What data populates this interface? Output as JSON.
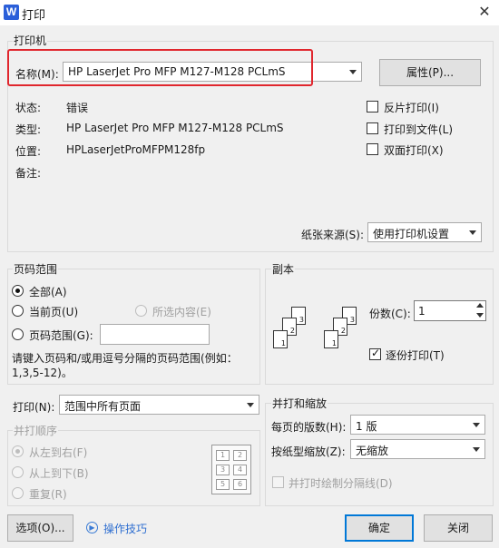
{
  "window": {
    "title": "打印",
    "app_icon": "W",
    "close": "✕"
  },
  "printer": {
    "group_title": "打印机",
    "name_label": "名称(M):",
    "selected": "HP LaserJet Pro MFP M127-M128 PCLmS",
    "properties_button": "属性(P)...",
    "status_label": "状态:",
    "status_value": "错误",
    "type_label": "类型:",
    "type_value": "HP LaserJet Pro MFP M127-M128 PCLmS",
    "location_label": "位置:",
    "location_value": "HPLaserJetProMFPM128fp",
    "comment_label": "备注:",
    "options": [
      {
        "label": "反片打印(I)",
        "checked": false
      },
      {
        "label": "打印到文件(L)",
        "checked": false
      },
      {
        "label": "双面打印(X)",
        "checked": false
      }
    ],
    "paper_source_label": "纸张来源(S):",
    "paper_source_value": "使用打印机设置"
  },
  "page_range": {
    "group_title": "页码范围",
    "all": "全部(A)",
    "current": "当前页(U)",
    "selection": "所选内容(E)",
    "range": "页码范围(G):",
    "range_value": "",
    "hint": "请键入页码和/或用逗号分隔的页码范围(例如：1,3,5-12)。"
  },
  "copies": {
    "group_title": "副本",
    "count_label": "份数(C):",
    "count_value": "1",
    "collate_label": "逐份打印(T)",
    "collate_checked": true
  },
  "print_what": {
    "label": "打印(N):",
    "value": "范围中所有页面"
  },
  "order": {
    "group_title": "并打顺序",
    "left_to_right": "从左到右(F)",
    "top_to_bottom": "从上到下(B)",
    "repeat": "重复(R)",
    "grid": [
      "1",
      "2",
      "3",
      "4",
      "5",
      "6"
    ]
  },
  "zoom": {
    "group_title": "并打和缩放",
    "pages_per_sheet_label": "每页的版数(H):",
    "pages_per_sheet_value": "1 版",
    "scale_label": "按纸型缩放(Z):",
    "scale_value": "无缩放",
    "draw_borders": "并打时绘制分隔线(D)"
  },
  "footer": {
    "options_button": "选项(O)...",
    "tips_link": "操作技巧",
    "ok_button": "确定",
    "close_button": "关闭"
  },
  "colors": {
    "highlight": "#e0262d",
    "accent": "#0078d7"
  }
}
